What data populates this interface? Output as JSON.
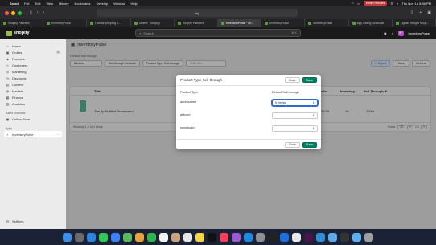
{
  "menubar": {
    "apple": "",
    "items": [
      "Safari",
      "File",
      "Edit",
      "View",
      "History",
      "Bookmarks",
      "Develop",
      "Window",
      "Help"
    ],
    "user_pill": "Heath Peeples",
    "clock": "Thu Nov 13  8:36 PM"
  },
  "browser": {
    "url": "🔒 🔒",
    "url_text": "w|"
  },
  "tabs": [
    {
      "label": "Shopify Partners",
      "active": false
    },
    {
      "label": "InventoryPulse",
      "active": false
    },
    {
      "label": "Handle shipping 1...",
      "active": false
    },
    {
      "label": "Orders · Shopify",
      "active": false
    },
    {
      "label": "Shopify Partners",
      "active": false
    },
    {
      "label": "InventoryPulse · Sh...",
      "active": true
    },
    {
      "label": "InventoryPulse",
      "active": false
    },
    {
      "label": "InventoryPulse",
      "active": false
    },
    {
      "label": "App Listing Schedule",
      "active": false
    },
    {
      "label": "Lighter Weight Shop...",
      "active": false
    }
  ],
  "shopbar": {
    "logo_text": "shopify",
    "search_placeholder": "Search",
    "search_shortcut": "⌘ K",
    "store_name": "InventoryPulse",
    "avatar": "IP"
  },
  "sidebar": {
    "items": [
      {
        "icon": "⌂",
        "label": "Home"
      },
      {
        "icon": "▣",
        "label": "Orders",
        "badge": "1"
      },
      {
        "icon": "◈",
        "label": "Products"
      },
      {
        "icon": "☺",
        "label": "Customers"
      },
      {
        "icon": "◎",
        "label": "Marketing"
      },
      {
        "icon": "%",
        "label": "Discounts"
      },
      {
        "icon": "▤",
        "label": "Content"
      },
      {
        "icon": "◍",
        "label": "Markets"
      },
      {
        "icon": "▦",
        "label": "Finance"
      },
      {
        "icon": "▥",
        "label": "Analytics"
      }
    ],
    "sales_channels_label": "Sales channels",
    "online_store": "Online Store",
    "apps_label": "Apps",
    "app_item": "InventoryPulse",
    "settings": "Settings"
  },
  "main": {
    "app_title": "InventoryPulse",
    "default_label": "Default Sell-through",
    "default_value": "6 weeks",
    "btn_defaults": "Sell-through Defaults",
    "btn_product_type": "Product Type Sell-through",
    "filter_placeholder": "Filter title...",
    "btn_export": "Export",
    "btn_history": "History",
    "btn_refresh": "Refresh",
    "headers": {
      "title": "Title",
      "sales": "Sales",
      "inventory": "Inventory",
      "sell_through": "Sell-Through ▼"
    },
    "row": {
      "name": "The 3p Fulfilled Snowboard",
      "sales": "$59.95",
      "inventory": "19",
      "sell_through": "100%"
    },
    "footer_text": "Showing 1-1 of 1 items",
    "rows_label": "Rows:",
    "rows_value": "10",
    "page_prev": "«",
    "page_label": "1/1",
    "page_next": "»"
  },
  "modal": {
    "title": "Product Type Sell-through",
    "close": "Close",
    "save": "Save",
    "col_type": "Product Type",
    "col_default": "Default Sell-through",
    "rows": [
      {
        "type": "accessories",
        "value": "6 weeks"
      },
      {
        "type": "giftcard",
        "value": ""
      },
      {
        "type": "snowboard",
        "value": ""
      }
    ],
    "close_footer": "Close",
    "save_footer": "Save"
  },
  "dock": {
    "icons": [
      {
        "name": "finder-icon",
        "color": "#3a8ee6"
      },
      {
        "name": "launchpad-icon",
        "color": "#6b6b6b"
      },
      {
        "name": "safari-icon",
        "color": "#2a84e0"
      },
      {
        "name": "messages-icon",
        "color": "#34c759"
      },
      {
        "name": "mail-icon",
        "color": "#3b82f6"
      },
      {
        "name": "maps-icon",
        "color": "#5cb85c"
      },
      {
        "name": "photos-icon",
        "color": "#e8a33c"
      },
      {
        "name": "facetime-icon",
        "color": "#2fb34a"
      },
      {
        "name": "calendar-icon",
        "color": "#f2f2f2"
      },
      {
        "name": "contacts-icon",
        "color": "#c9a27a"
      },
      {
        "name": "reminders-icon",
        "color": "#e6e6e6"
      },
      {
        "name": "notes-icon",
        "color": "#f5d34a"
      },
      {
        "name": "tv-icon",
        "color": "#111111"
      },
      {
        "name": "music-icon",
        "color": "#f3415a"
      },
      {
        "name": "podcasts-icon",
        "color": "#9b59d6"
      },
      {
        "name": "appstore-icon",
        "color": "#1e88e5"
      },
      {
        "name": "settings-icon",
        "color": "#8e8e93"
      },
      {
        "name": "terminal-icon",
        "color": "#222222"
      },
      {
        "name": "xcode-icon",
        "color": "#1d6fe0"
      },
      {
        "name": "chrome-icon",
        "color": "#e8e8e8"
      },
      {
        "name": "slack-icon",
        "color": "#4a154b"
      },
      {
        "name": "vscode-icon",
        "color": "#2f8fdc"
      },
      {
        "name": "preview-icon",
        "color": "#5fa8e8"
      },
      {
        "name": "activity-icon",
        "color": "#333333"
      },
      {
        "name": "folder-icon",
        "color": "#5ab0f0"
      },
      {
        "name": "trash-icon",
        "color": "#9e9e9e"
      }
    ]
  }
}
